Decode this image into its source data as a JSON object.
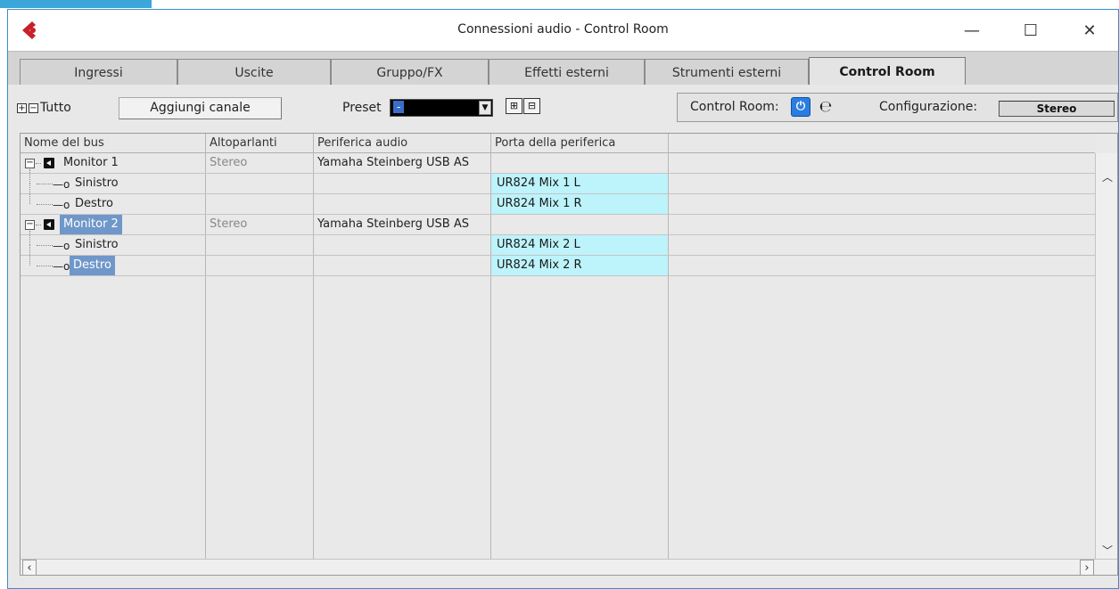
{
  "window": {
    "title": "Connessioni audio - Control Room",
    "logo_icon": "cubase-logo-icon",
    "accent_color": "#3aa6da",
    "minimize_glyph": "—",
    "maximize_glyph": "☐",
    "close_glyph": "✕"
  },
  "tabs": [
    {
      "label": "Ingressi",
      "active": false
    },
    {
      "label": "Uscite",
      "active": false
    },
    {
      "label": "Gruppo/FX",
      "active": false
    },
    {
      "label": "Effetti esterni",
      "active": false
    },
    {
      "label": "Strumenti esterni",
      "active": false
    },
    {
      "label": "Control Room",
      "active": true
    }
  ],
  "toolbar": {
    "expand_all_glyph": "+",
    "collapse_all_glyph": "−",
    "all_label": "Tutto",
    "add_channel_label": "Aggiungi canale",
    "preset_label": "Preset",
    "preset_value": "-",
    "control_room_label": "Control Room:",
    "config_label": "Configurazione:",
    "config_value": "Stereo"
  },
  "grid": {
    "columns": [
      "Nome del bus",
      "Altoparlanti",
      "Periferica audio",
      "Porta della periferica"
    ],
    "rows": [
      {
        "kind": "bus",
        "name": "Monitor 1",
        "speakers": "Stereo",
        "device": "Yamaha Steinberg USB AS",
        "port": "",
        "selected": false
      },
      {
        "kind": "channel",
        "name": "Sinistro",
        "speakers": "",
        "device": "",
        "port": "UR824 Mix 1 L",
        "selected": false
      },
      {
        "kind": "channel",
        "name": "Destro",
        "speakers": "",
        "device": "",
        "port": "UR824 Mix 1 R",
        "selected": false
      },
      {
        "kind": "bus",
        "name": "Monitor 2",
        "speakers": "Stereo",
        "device": "Yamaha Steinberg USB AS",
        "port": "",
        "selected": true
      },
      {
        "kind": "channel",
        "name": "Sinistro",
        "speakers": "",
        "device": "",
        "port": "UR824 Mix 2 L",
        "selected": false
      },
      {
        "kind": "channel",
        "name": "Destro",
        "speakers": "",
        "device": "",
        "port": "UR824 Mix 2 R",
        "selected": true
      }
    ],
    "port_highlight_color": "#bdf3fb",
    "selection_color": "#6f97c9"
  }
}
